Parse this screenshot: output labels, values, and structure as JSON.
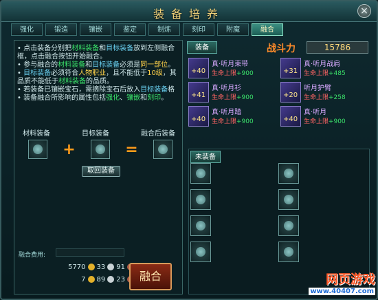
{
  "window": {
    "title": "装备培养",
    "close_glyph": "×"
  },
  "tabs": [
    "强化",
    "锻造",
    "镶嵌",
    "鉴定",
    "制炼",
    "刻印",
    "附魔",
    "融合"
  ],
  "active_tab_index": 7,
  "intro": [
    [
      [
        "• 点击装备分别把",
        ""
      ],
      [
        "材料装备",
        "g"
      ],
      [
        "和",
        ""
      ],
      [
        "目标装备",
        "c"
      ],
      [
        "放到左侧融合",
        ""
      ]
    ],
    [
      [
        "  框，点击融合按钮开始融合。",
        ""
      ]
    ],
    [
      [
        "• 参与融合的",
        ""
      ],
      [
        "材料装备",
        "g"
      ],
      [
        "和",
        ""
      ],
      [
        "目标装备",
        "c"
      ],
      [
        "必须是",
        ""
      ],
      [
        "同一部位",
        "y"
      ],
      [
        "。",
        ""
      ]
    ],
    [
      [
        "• ",
        ""
      ],
      [
        "目标装备",
        "c"
      ],
      [
        "必须符合",
        ""
      ],
      [
        "人物职业",
        "y"
      ],
      [
        "，且不能低于",
        ""
      ],
      [
        "10级",
        "y"
      ],
      [
        "，其",
        ""
      ]
    ],
    [
      [
        "  品质不能低于",
        ""
      ],
      [
        "材料装备",
        "g"
      ],
      [
        "的品质。",
        ""
      ]
    ],
    [
      [
        "• 若装备已镶嵌宝石，需摘除宝石后放入",
        ""
      ],
      [
        "目标装备",
        "c"
      ],
      [
        "格",
        ""
      ]
    ],
    [
      [
        "• 装备融合所影响的属性包括",
        ""
      ],
      [
        "强化",
        "g"
      ],
      [
        "、",
        ""
      ],
      [
        "镶嵌",
        "g"
      ],
      [
        "和",
        ""
      ],
      [
        "刻印",
        "g"
      ],
      [
        "。",
        ""
      ]
    ]
  ],
  "fusion": {
    "material_label": "材料装备",
    "target_label": "目标装备",
    "result_label": "融合后装备",
    "plus": "+",
    "equals": "=",
    "retrieve_button": "取回装备",
    "cost_label": "融合费用:",
    "fuse_button": "融合"
  },
  "currency": {
    "row1": [
      "5770",
      "33",
      "91"
    ],
    "row2": [
      "7",
      "89",
      "23"
    ]
  },
  "equipment_tab": "装备",
  "combat_power": {
    "label": "战斗力",
    "value": "15786"
  },
  "equipment": [
    {
      "ench": "+40",
      "level": "",
      "name": "真·听月束带",
      "stat": "生命上限",
      "value": "+900"
    },
    {
      "ench": "+31",
      "level": "",
      "name": "真·听月战肩",
      "stat": "生命上限",
      "value": "+485"
    },
    {
      "ench": "+41",
      "level": "",
      "name": "真·听月衫",
      "stat": "生命上限",
      "value": "+900"
    },
    {
      "ench": "+20",
      "level": "",
      "name": "听月护臂",
      "stat": "生命上限",
      "value": "+258"
    },
    {
      "ench": "+40",
      "level": "",
      "name": "真·听月踏",
      "stat": "生命上限",
      "value": "+900"
    },
    {
      "ench": "+40",
      "level": "",
      "name": "真·听月",
      "stat": "生命上限",
      "value": "+900"
    }
  ],
  "unequipped_tab": "未装备",
  "logo": {
    "line1": "网页游戏",
    "line2": "www.40407.com"
  }
}
